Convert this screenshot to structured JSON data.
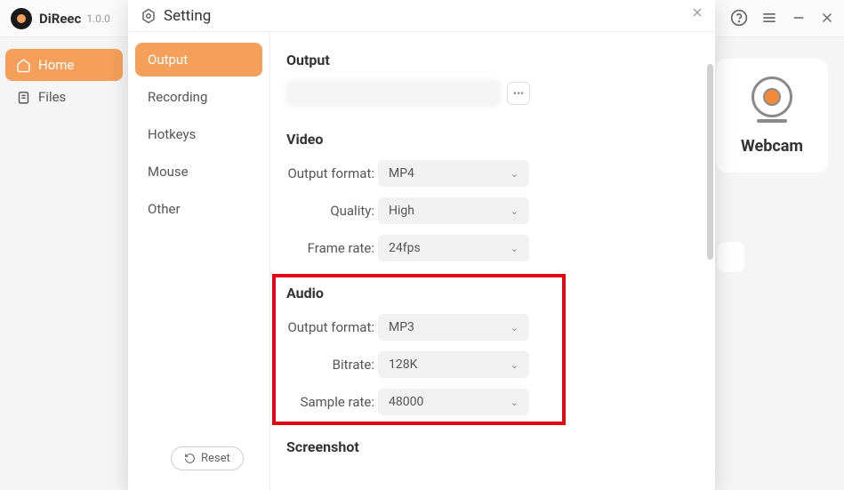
{
  "app": {
    "name": "DiReec",
    "version": "1.0.0"
  },
  "sidebar": {
    "items": [
      {
        "label": "Home",
        "active": true
      },
      {
        "label": "Files",
        "active": false
      }
    ]
  },
  "mode": {
    "webcam_label": "Webcam"
  },
  "modal": {
    "title": "Setting",
    "nav": [
      {
        "label": "Output",
        "active": true
      },
      {
        "label": "Recording"
      },
      {
        "label": "Hotkeys"
      },
      {
        "label": "Mouse"
      },
      {
        "label": "Other"
      }
    ],
    "reset_label": "Reset",
    "sections": {
      "output": {
        "title": "Output"
      },
      "video": {
        "title": "Video",
        "format_label": "Output format:",
        "format_value": "MP4",
        "quality_label": "Quality:",
        "quality_value": "High",
        "framerate_label": "Frame rate:",
        "framerate_value": "24fps"
      },
      "audio": {
        "title": "Audio",
        "format_label": "Output format:",
        "format_value": "MP3",
        "bitrate_label": "Bitrate:",
        "bitrate_value": "128K",
        "samplerate_label": "Sample rate:",
        "samplerate_value": "48000"
      },
      "screenshot": {
        "title": "Screenshot"
      }
    }
  }
}
